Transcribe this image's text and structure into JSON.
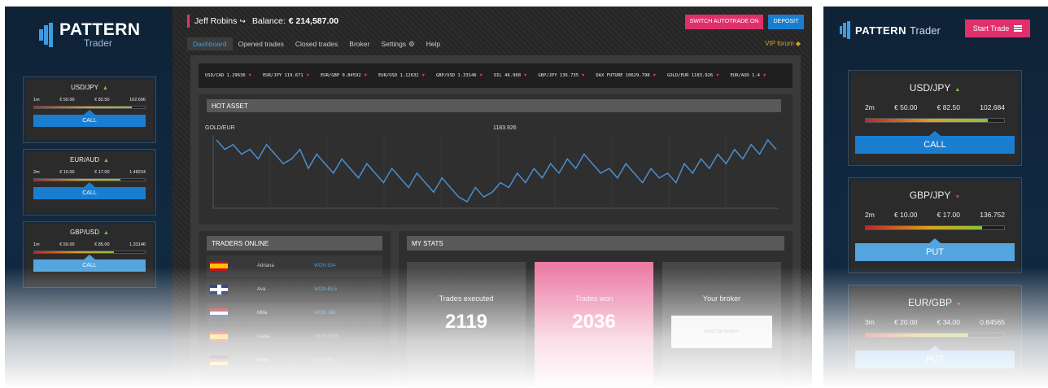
{
  "brand": {
    "word1": "PATTERN",
    "word2": "Trader"
  },
  "left_cards": [
    {
      "pair": "USD/JPY",
      "dir": "up",
      "expiry": "1m",
      "amount1": "€ 50.00",
      "amount2": "€ 82.50",
      "rate": "102.696",
      "level": 0.88,
      "action": "CALL",
      "action_type": "call"
    },
    {
      "pair": "EUR/AUD",
      "dir": "up",
      "expiry": "2m",
      "amount1": "€ 10.00",
      "amount2": "€ 17.00",
      "rate": "1.48224",
      "level": 0.78,
      "action": "CALL",
      "action_type": "call"
    },
    {
      "pair": "GBP/USD",
      "dir": "up",
      "expiry": "1m",
      "amount1": "€ 50.00",
      "amount2": "€ 85.00",
      "rate": "1.33146",
      "level": 0.72,
      "action": "CALL",
      "action_type": "put"
    }
  ],
  "header": {
    "user_name": "Jeff Robins",
    "balance_label": "Balance:",
    "balance_value": "€ 214,587.00",
    "switch_button": "SWITCH AUTOTRADE ON",
    "deposit_button": "DEPOSIT",
    "vip_link": "VIP forum"
  },
  "tabs": [
    {
      "label": "Dashboard",
      "active": true
    },
    {
      "label": "Opened trades",
      "active": false
    },
    {
      "label": "Closed trades",
      "active": false
    },
    {
      "label": "Broker",
      "active": false
    },
    {
      "label": "Settings",
      "active": false
    },
    {
      "label": "Help",
      "active": false
    }
  ],
  "ticker": [
    "USD/CAD 1.29636",
    "EUR/JPY 119.671",
    "EUR/GBP 0.84592",
    "EUR/USD 1.12632",
    "GBP/USD 1.33146",
    "OIL 46.968",
    "GBP/JPY 136.735",
    "DAX FUTURE 10629.798",
    "GOLD/EUR 1183.926",
    "EUR/AUD 1.4"
  ],
  "hot_asset": {
    "section_title": "HOT ASSET",
    "asset": "GOLD/EUR",
    "current_value": "1183.926"
  },
  "chart_data": {
    "type": "line",
    "title": "GOLD/EUR",
    "series": [
      {
        "values": [
          1183.95,
          1183.93,
          1183.94,
          1183.92,
          1183.93,
          1183.91,
          1183.94,
          1183.92,
          1183.9,
          1183.91,
          1183.93,
          1183.89,
          1183.92,
          1183.9,
          1183.88,
          1183.91,
          1183.89,
          1183.87,
          1183.9,
          1183.88,
          1183.86,
          1183.89,
          1183.87,
          1183.85,
          1183.88,
          1183.86,
          1183.84,
          1183.87,
          1183.85,
          1183.83,
          1183.82,
          1183.85,
          1183.83,
          1183.84,
          1183.86,
          1183.85,
          1183.88,
          1183.86,
          1183.89,
          1183.87,
          1183.9,
          1183.88,
          1183.91,
          1183.89,
          1183.92,
          1183.9,
          1183.88,
          1183.89,
          1183.87,
          1183.9,
          1183.88,
          1183.86,
          1183.89,
          1183.87,
          1183.88,
          1183.86,
          1183.9,
          1183.88,
          1183.91,
          1183.89,
          1183.92,
          1183.9,
          1183.93,
          1183.91,
          1183.94,
          1183.92,
          1183.95,
          1183.93
        ]
      }
    ]
  },
  "traders": {
    "section_title": "TRADERS ONLINE",
    "rows": [
      {
        "flag": "es",
        "name": "Adriana",
        "won": "WON $34"
      },
      {
        "flag": "uk",
        "name": "Ava",
        "won": "WON €8,5"
      },
      {
        "flag": "nl",
        "name": "Milla",
        "won": "WON 18€"
      },
      {
        "flag": "es",
        "name": "Laura",
        "won": "WON $686"
      },
      {
        "flag": "de",
        "name": "Henri",
        "won": "WON 9€"
      }
    ]
  },
  "stats": {
    "section_title": "MY STATS",
    "trades_executed_label": "Trades executed",
    "trades_executed_value": "2119",
    "trades_won_label": "Trades won",
    "trades_won_value": "2036",
    "broker_label": "Your broker",
    "broker_name": "BANC DE BINARY"
  },
  "right": {
    "start_trade": "Start Trade",
    "cards": [
      {
        "pair": "USD/JPY",
        "dir": "up",
        "expiry": "2m",
        "amount1": "€ 50.00",
        "amount2": "€ 82.50",
        "rate": "102.684",
        "level": 0.88,
        "action": "CALL",
        "action_type": "call"
      },
      {
        "pair": "GBP/JPY",
        "dir": "down",
        "expiry": "2m",
        "amount1": "€ 10.00",
        "amount2": "€ 17.00",
        "rate": "136.752",
        "level": 0.84,
        "action": "PUT",
        "action_type": "put"
      },
      {
        "pair": "EUR/GBP",
        "dir": "down",
        "expiry": "3m",
        "amount1": "€ 20.00",
        "amount2": "€ 34.00",
        "rate": "0.84565",
        "level": 0.74,
        "action": "PUT",
        "action_type": "put"
      }
    ]
  }
}
